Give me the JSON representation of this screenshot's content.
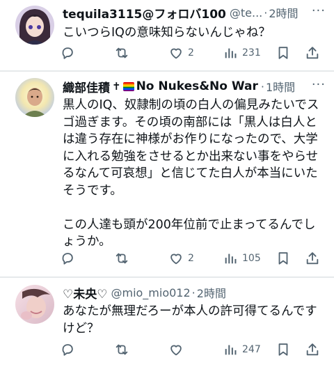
{
  "tweets": [
    {
      "name": "tequila3115@フォロバ100",
      "handle": "@te...",
      "separator": "·",
      "time": "2時間",
      "more": "···",
      "text": [
        "こいつらIQの意味知らないんじゃね？"
      ],
      "stats": {
        "reply": "",
        "retweet": "",
        "like": "2",
        "views": "231"
      }
    },
    {
      "name": "織部佳積",
      "name_suffix": "No Nukes&No War",
      "dagger": "✝",
      "separator": "·",
      "time": "1時間",
      "more": "···",
      "text": [
        "黒人のIQ、奴隷制の頃の白人の偏見みたいでス",
        "ゴ過ぎます。その頃の南部には「黒人は白人と",
        "は違う存在に神様がお作りになったので、大学",
        "に入れる勉強をさせるとか出来ない事をやらせ",
        "るなんて可哀想」と信じてた白人が本当にいた",
        "そうです。",
        "",
        "この人達も頭が200年位前で止まってるんでし",
        "ょうか。"
      ],
      "stats": {
        "reply": "",
        "retweet": "",
        "like": "2",
        "views": "105"
      }
    },
    {
      "name": "♡未央♡",
      "handle": "@mio_mio012",
      "separator": "·",
      "time": "2時間",
      "more": "",
      "text": [
        "あなたが無理だろーが本人の許可得てるんです",
        "けど？"
      ],
      "stats": {
        "reply": "",
        "retweet": "",
        "like": "",
        "views": "247"
      }
    }
  ],
  "colors": {
    "text": "#0f1419",
    "secondary": "#536471",
    "divider": "#eff3f4"
  },
  "icons": [
    "reply-icon",
    "retweet-icon",
    "like-icon",
    "views-icon",
    "bookmark-icon",
    "share-icon"
  ]
}
